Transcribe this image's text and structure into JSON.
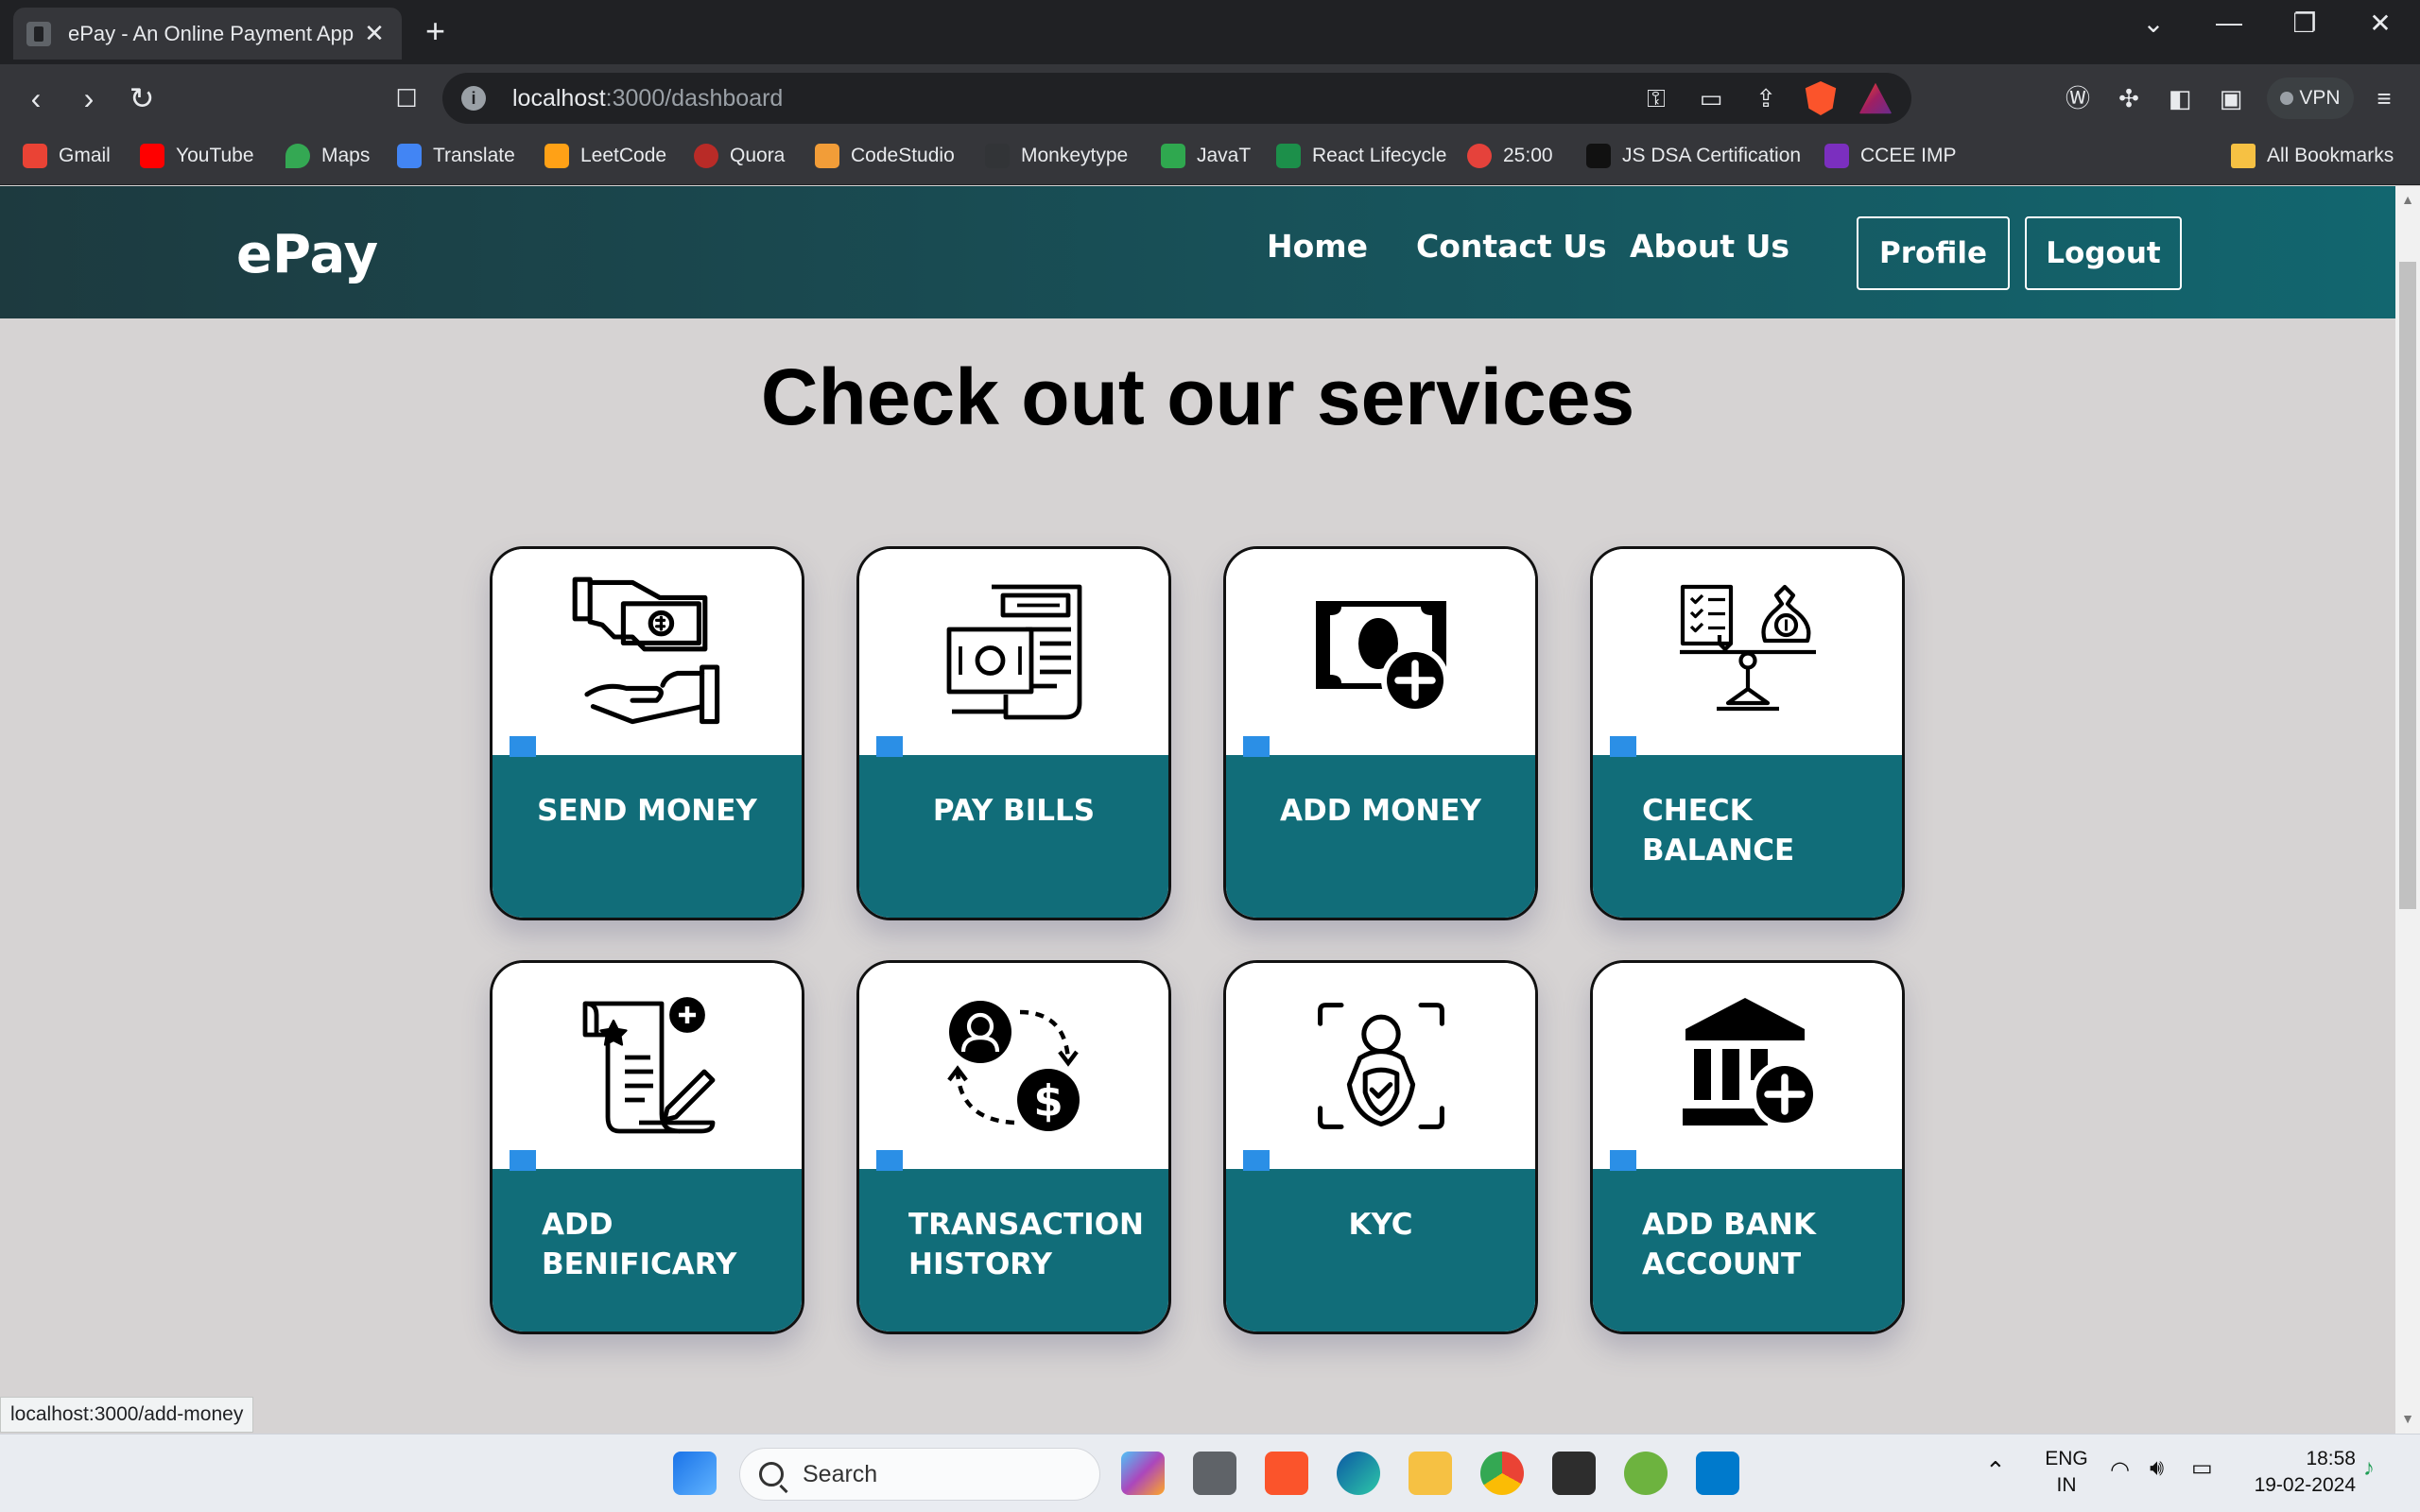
{
  "browser": {
    "tab_title": "ePay - An Online Payment App",
    "tab_close": "✕",
    "new_tab": "+",
    "url_host": "localhost",
    "url_path": ":3000/dashboard",
    "vpn_label": "VPN",
    "bookmarks": [
      "Gmail",
      "YouTube",
      "Maps",
      "Translate",
      "LeetCode",
      "Quora",
      "CodeStudio",
      "Monkeytype",
      "JavaT",
      "React Lifecycle",
      "25:00",
      "JS DSA Certification",
      "CCEE IMP"
    ],
    "all_bookmarks": "All Bookmarks",
    "status_url": "localhost:3000/add-money"
  },
  "navbar": {
    "brand": "ePay",
    "links": [
      "Home",
      "Contact Us",
      "About Us"
    ],
    "profile_button": "Profile",
    "logout_button": "Logout"
  },
  "main": {
    "heading": "Check out our services",
    "services": [
      {
        "label": "SEND MONEY",
        "icon": "hand-cash-icon"
      },
      {
        "label": "PAY BILLS",
        "icon": "bill-receipt-icon"
      },
      {
        "label": "ADD MONEY",
        "icon": "add-cash-icon"
      },
      {
        "label": "CHECK BALANCE",
        "icon": "balance-scale-icon"
      },
      {
        "label": "ADD BENIFICARY",
        "icon": "add-document-icon"
      },
      {
        "label": "TRANSACTION HISTORY",
        "icon": "transaction-cycle-icon"
      },
      {
        "label": "KYC",
        "icon": "face-scan-icon"
      },
      {
        "label": "ADD BANK ACCOUNT",
        "icon": "add-bank-icon"
      }
    ]
  },
  "taskbar": {
    "search_placeholder": "Search",
    "lang_top": "ENG",
    "lang_bottom": "IN",
    "time": "18:58",
    "date": "19-02-2024"
  },
  "colors": {
    "card_bottom": "#116d79",
    "accent": "#2b8fe6",
    "navbar_start": "#1d3a3f",
    "navbar_end": "#12666f"
  }
}
